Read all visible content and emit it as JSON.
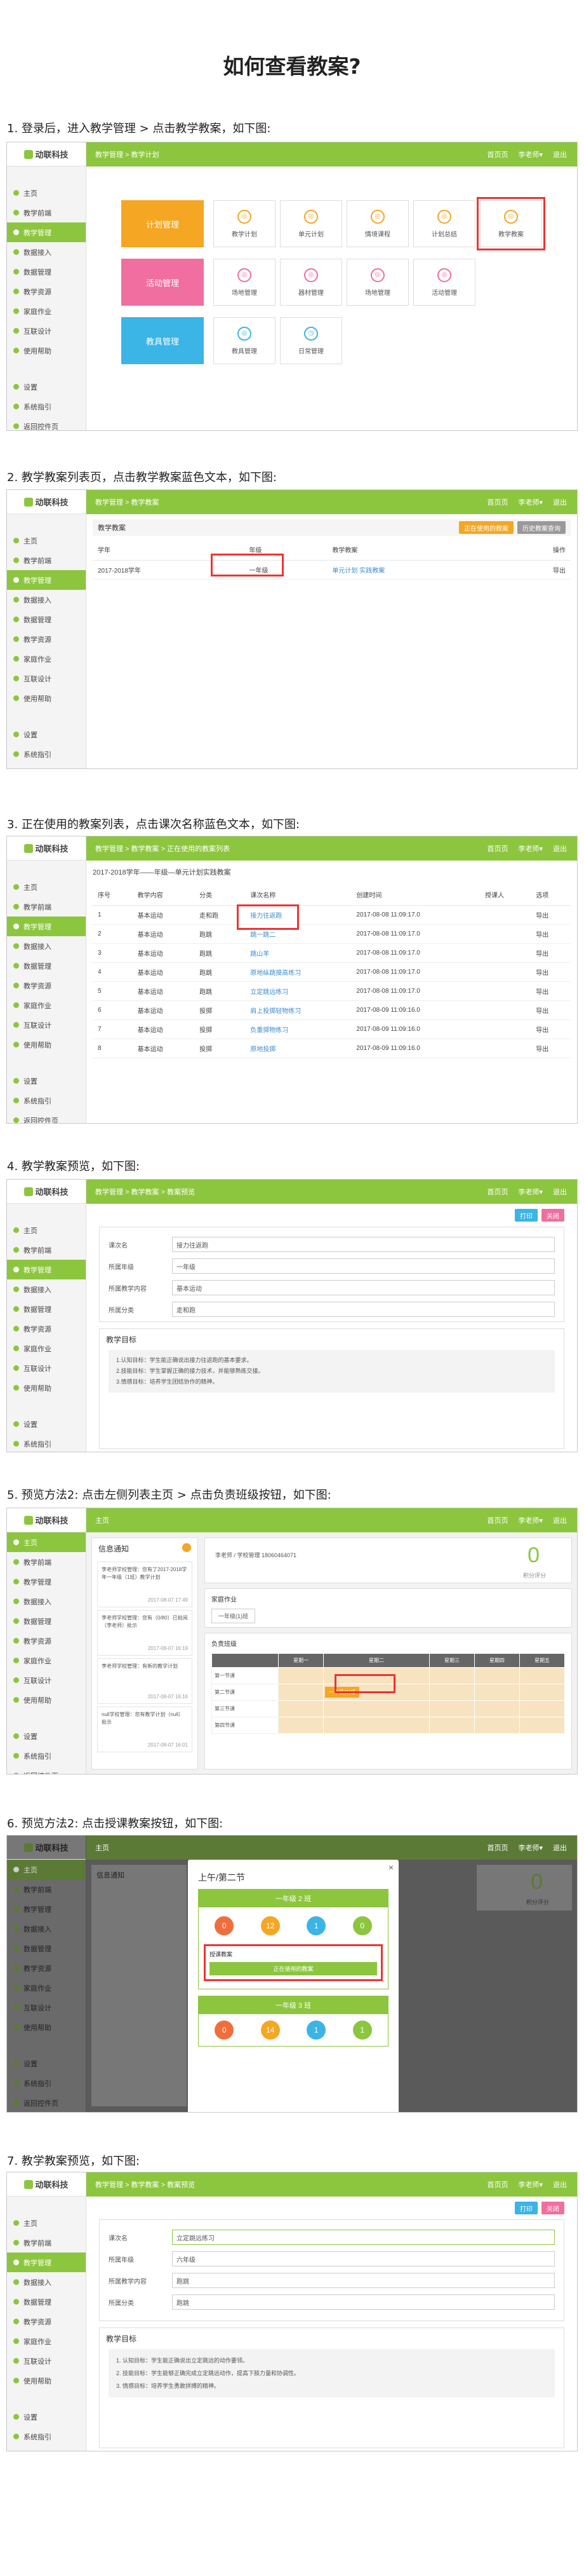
{
  "title": "如何查看教案?",
  "steps": [
    "1. 登录后，进入教学管理 > 点击教学教案，如下图:",
    "2. 教学教案列表页，点击教学教案蓝色文本，如下图:",
    "3. 正在使用的教案列表，点击课次名称蓝色文本，如下图:",
    "4. 教学教案预览，如下图:",
    "5. 预览方法2: 点击左侧列表主页 > 点击负责班级按钮，如下图:",
    "6. 预览方法2: 点击授课教案按钮，如下图:",
    "7. 教学教案预览，如下图:"
  ],
  "brand": {
    "logo": "动联科技",
    "green": "#8cc63f",
    "highlight": "#ee3333"
  },
  "sidebar": {
    "items": [
      "主页",
      "教学前端",
      "教学管理",
      "数据接入",
      "数据管理",
      "教学资源",
      "家庭作业",
      "互联设计",
      "使用帮助"
    ],
    "bottom": [
      "设置",
      "系统指引",
      "返回控件页"
    ]
  },
  "topbar": {
    "home": "首页页",
    "user": "李老师▾",
    "logout": "退出"
  },
  "s1": {
    "crumb": "教学管理 > 教学计划",
    "big": [
      "计划管理",
      "活动管理",
      "教具管理"
    ],
    "row1": [
      "教学计划",
      "单元计划",
      "情境课程",
      "计划总结",
      "教学教案"
    ],
    "row2": [
      "场地管理",
      "器材管理",
      "场地管理",
      "活动管理"
    ],
    "row3": [
      "教具管理",
      "日常管理"
    ]
  },
  "s2": {
    "crumb": "教学管理 > 教学教案",
    "btn_orange": "正在使用的教案",
    "btn_gray": "历史教案查询",
    "panel_title": "教学教案",
    "headers": [
      "学年",
      "年级",
      "教学教案",
      "操作"
    ],
    "row": [
      "2017-2018学年",
      "一年级",
      "单元计划 实践教案",
      "导出"
    ]
  },
  "s3": {
    "crumb": "教学管理 > 教学教案 > 正在使用的教案列表",
    "panel_title": "2017-2018学年——年级—单元计划实践教案",
    "headers": [
      "序号",
      "教学内容",
      "分类",
      "课次名称",
      "创建时间",
      "授课人",
      "选项"
    ],
    "rows": [
      [
        "1",
        "基本运动",
        "走和跑",
        "接力往返跑",
        "2017-08-08 11:09:17.0",
        "",
        "导出"
      ],
      [
        "2",
        "基本运动",
        "跑跳",
        "跳一跳二",
        "2017-08-08 11:09:17.0",
        "",
        "导出"
      ],
      [
        "3",
        "基本运动",
        "跑跳",
        "跳山羊",
        "2017-08-08 11:09:17.0",
        "",
        "导出"
      ],
      [
        "4",
        "基本运动",
        "跑跳",
        "原地纵跳摸高练习",
        "2017-08-08 11:09:17.0",
        "",
        "导出"
      ],
      [
        "5",
        "基本运动",
        "跑跳",
        "立定跳远练习",
        "2017-08-08 11:09:17.0",
        "",
        "导出"
      ],
      [
        "6",
        "基本运动",
        "投掷",
        "肩上投掷轻物练习",
        "2017-08-09 11:09:16.0",
        "",
        "导出"
      ],
      [
        "7",
        "基本运动",
        "投掷",
        "负重掷物练习",
        "2017-08-09 11:09:16.0",
        "",
        "导出"
      ],
      [
        "8",
        "基本运动",
        "投掷",
        "原地投掷",
        "2017-08-09 11:09:16.0",
        "",
        "导出"
      ]
    ]
  },
  "s4": {
    "crumb": "教学管理 > 教学教案 > 教案预览",
    "btn_print": "打印",
    "btn_close": "关闭",
    "fields": [
      {
        "label": "课次名",
        "value": "接力往返跑"
      },
      {
        "label": "所属年级",
        "value": "一年级"
      },
      {
        "label": "所属教学内容",
        "value": "基本运动"
      },
      {
        "label": "所属分类",
        "value": "走和跑"
      }
    ],
    "goal_title": "教学目标",
    "goals": [
      "1.认知目标：学生能正确说出接力往返跑的基本要求。",
      "2.技能目标：学生掌握正确的接力技术，并能够熟练交接。",
      "3.情感目标：培养学生团结协作的精神。"
    ]
  },
  "s5": {
    "notice_title": "信息通知",
    "notices": [
      {
        "text": "李老师学校管理：您有了2017-2018学年一年级（1班）教学计划",
        "time": "2017-08-07 17:49"
      },
      {
        "text": "李老师学校管理：您有（0/80）已批阅（李老师）批示",
        "time": "2017-08-07 16:19"
      },
      {
        "text": "李老师学校管理：有新的教学计划",
        "time": "2017-08-07 16:16"
      },
      {
        "text": "null学校管理：您有教学计划（null）批示",
        "time": "2017-08-07 16:01"
      }
    ],
    "teacher_info": "李老师 / 学校管理 18060464071",
    "score": "0",
    "score_label": "积分评分",
    "homework_title": "家庭作业",
    "homework_tag": "一年级(1)班",
    "class_title": "负责班级",
    "days": [
      "",
      "星期一",
      "星期二",
      "星期三",
      "星期四",
      "星期五"
    ],
    "periods": [
      "第一节课",
      "第二节课",
      "第三节课",
      "第四节课"
    ],
    "class_cell": "一年级(1)班"
  },
  "s6": {
    "modal_title": "上午/第二节",
    "class_a": "一年级 2 班",
    "class_b": "一年级 3 班",
    "stats_a": [
      "0",
      "12",
      "1",
      "0"
    ],
    "stats_b": [
      "0",
      "14",
      "1",
      "1"
    ],
    "plan_label": "授课教案",
    "plan_button": "正在使用的教案"
  },
  "s7": {
    "fields": [
      {
        "label": "课次名",
        "value": "立定跳远练习"
      },
      {
        "label": "所属年级",
        "value": "六年级"
      },
      {
        "label": "所属教学内容",
        "value": "跑跳"
      },
      {
        "label": "所属分类",
        "value": "跑跳"
      }
    ],
    "goals": [
      "1. 认知目标：学生能正确说出立定跳远的动作要领。",
      "2. 技能目标：学生能够正确完成立定跳远动作，提高下肢力量和协调性。",
      "3. 情感目标：培养学生勇敢拼搏的精神。"
    ]
  }
}
